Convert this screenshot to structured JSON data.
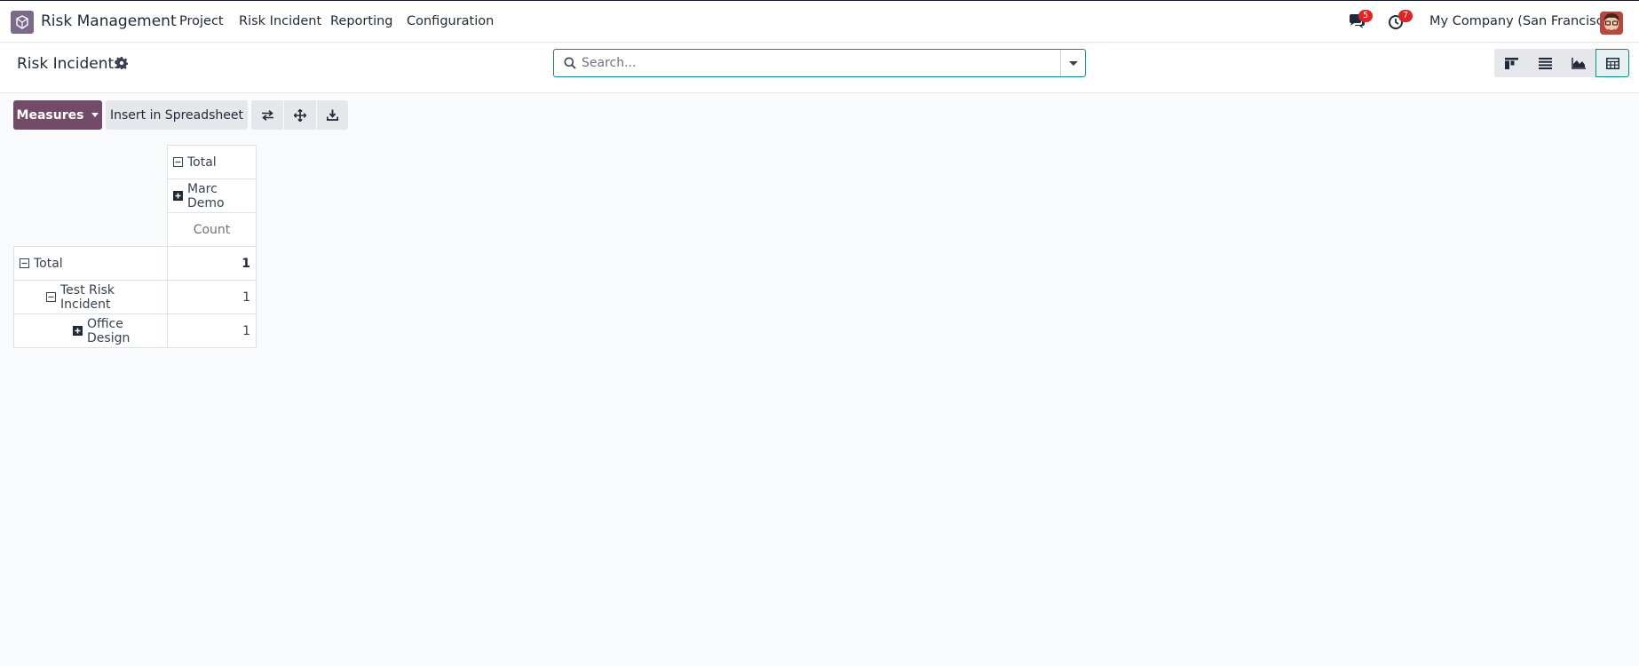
{
  "app": {
    "name": "Risk Management",
    "menu": [
      "Project",
      "Risk Incident",
      "Reporting",
      "Configuration"
    ]
  },
  "systray": {
    "messages_badge": "5",
    "activities_badge": "7",
    "company": "My Company (San Francisco)"
  },
  "control_panel": {
    "title": "Risk Incidents",
    "search_placeholder": "Search..."
  },
  "toolbar": {
    "measures_label": "Measures",
    "insert_label": "Insert in Spreadsheet"
  },
  "pivot": {
    "col_header_total": "Total",
    "col_group": "Marc Demo",
    "measure": "Count",
    "rows": [
      {
        "label": "Total",
        "value": "1"
      },
      {
        "label": "Test Risk Incident",
        "value": "1"
      },
      {
        "label": "Office Design",
        "value": "1"
      }
    ]
  },
  "colors": {
    "brand": "#714b67",
    "accent": "#0e8a8a",
    "badge": "#dc2626"
  }
}
